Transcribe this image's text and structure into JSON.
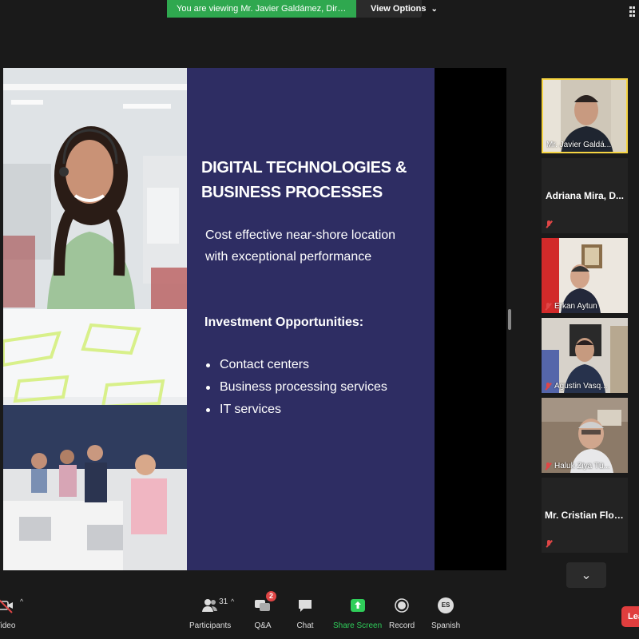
{
  "banner": {
    "viewing_text": "You are viewing Mr. Javier Galdámez, Director ...'s screen",
    "view_options_label": "View Options",
    "view_options_caret": "⌄"
  },
  "slide": {
    "title_line1": "DIGITAL TECHNOLOGIES  &",
    "title_line2": "BUSINESS PROCESSES",
    "subtitle": "Cost effective near-shore location with exceptional performance",
    "heading": "Investment Opportunities:",
    "bullets": [
      "Contact centers",
      "Business processing services",
      "IT services"
    ]
  },
  "participants_panel": {
    "tiles": [
      {
        "name": "Mr. Javier Galdá...",
        "type": "video",
        "active": true
      },
      {
        "name": "Adriana Mira, D...",
        "type": "name",
        "muted": true
      },
      {
        "name": "Erkan Aytun",
        "type": "video",
        "muted": true
      },
      {
        "name": "Agustin Vasq...",
        "type": "video",
        "muted": true
      },
      {
        "name": "Haluk Ziya Tü...",
        "type": "video",
        "muted": true
      },
      {
        "name": "Mr. Cristian Flor...",
        "type": "name",
        "muted": true
      }
    ],
    "scroll_down_glyph": "⌄"
  },
  "toolbar": {
    "video_label": "Video",
    "participants_label": "Participants",
    "participants_count": "31",
    "qa_label": "Q&A",
    "qa_badge": "2",
    "chat_label": "Chat",
    "share_label": "Share Screen",
    "record_label": "Record",
    "language_label": "Spanish",
    "language_code": "ES",
    "leave_label": "Leave",
    "caret": "^"
  },
  "colors": {
    "share_green": "#2fce5a",
    "slide_bg": "#2e2d63",
    "active_border": "#f5d442",
    "leave_red": "#e03e3e"
  }
}
